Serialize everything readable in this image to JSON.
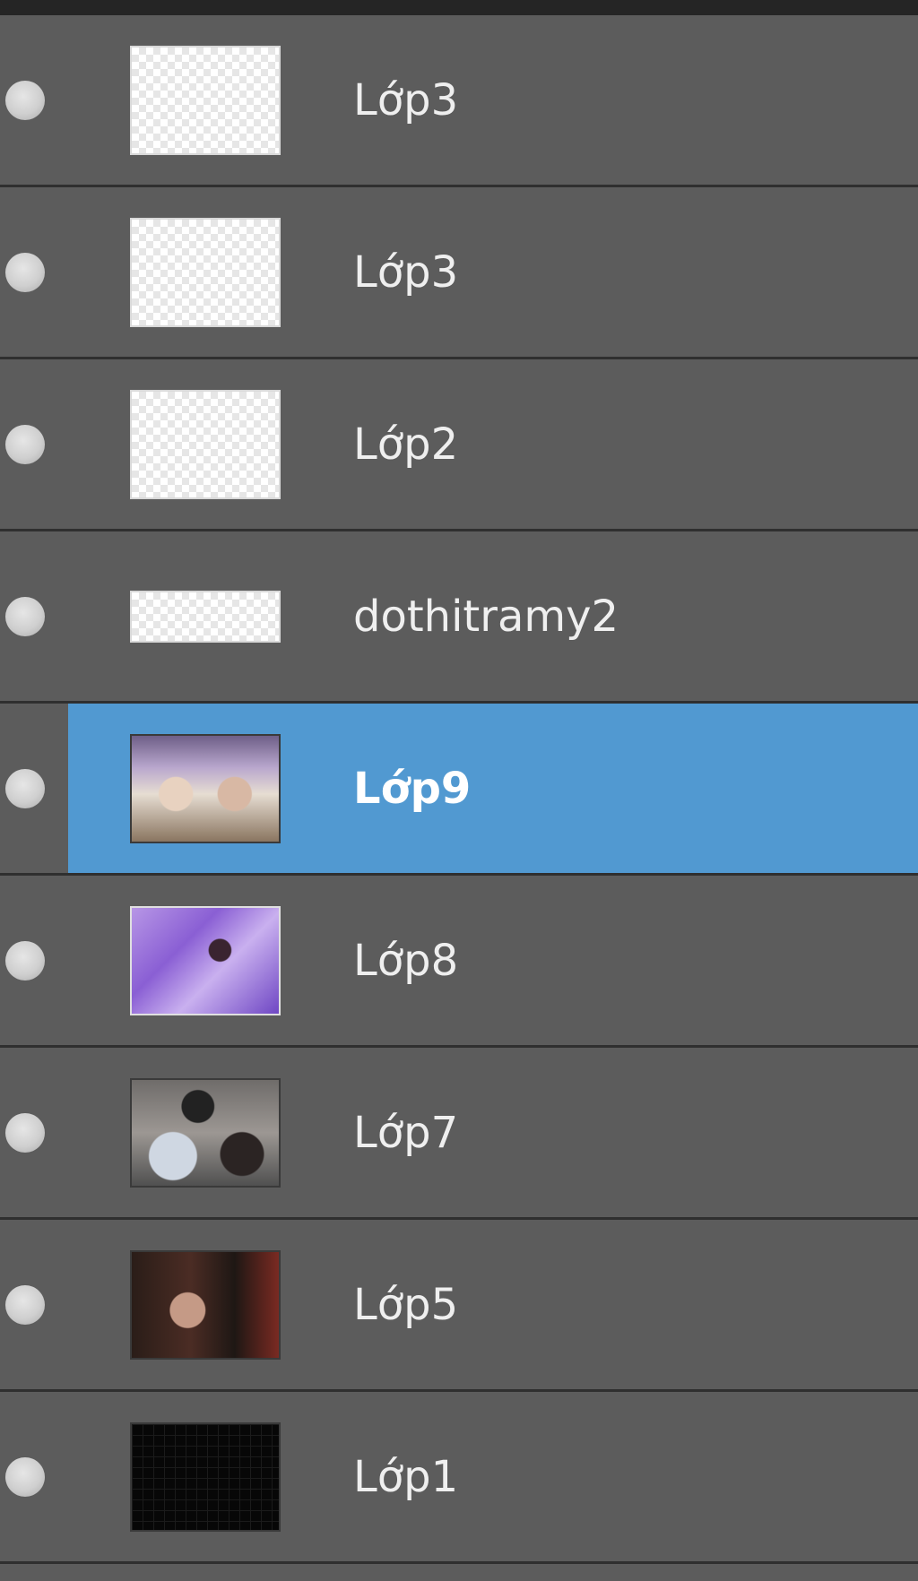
{
  "colors": {
    "panel_background": "#5c5c5c",
    "row_divider": "#2f2f2f",
    "selected_row": "#5199d1",
    "label_text": "#efefef",
    "top_bar": "#252525"
  },
  "visibility_icon": "eye-toggle-icon",
  "layers": [
    {
      "name": "Lớp3",
      "thumbnail": "transparent",
      "selected": false
    },
    {
      "name": "Lớp3",
      "thumbnail": "transparent",
      "selected": false
    },
    {
      "name": "Lớp2",
      "thumbnail": "transparent",
      "selected": false
    },
    {
      "name": "dothitramy2",
      "thumbnail": "transparent-wide",
      "selected": false
    },
    {
      "name": "Lớp9",
      "thumbnail": "photo",
      "selected": true
    },
    {
      "name": "Lớp8",
      "thumbnail": "photo",
      "selected": false
    },
    {
      "name": "Lớp7",
      "thumbnail": "photo",
      "selected": false
    },
    {
      "name": "Lớp5",
      "thumbnail": "photo",
      "selected": false
    },
    {
      "name": "Lớp1",
      "thumbnail": "black",
      "selected": false
    }
  ]
}
